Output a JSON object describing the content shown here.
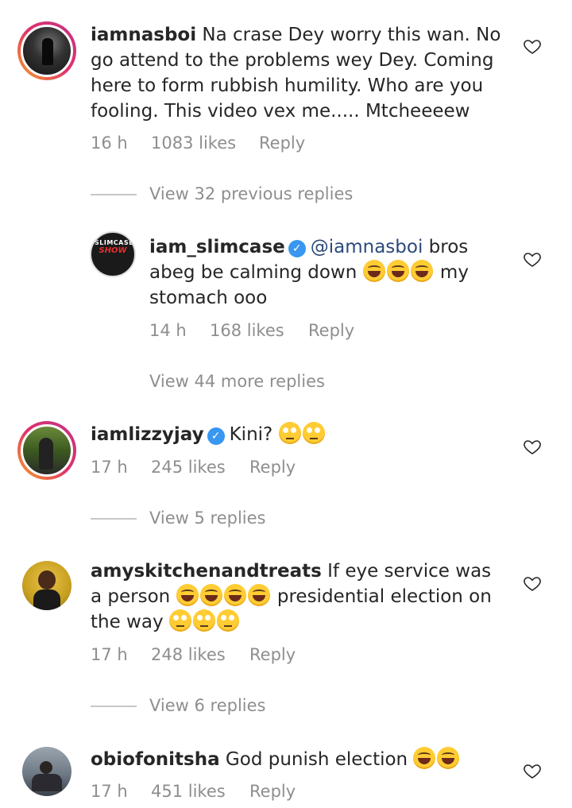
{
  "comments": [
    {
      "username": "iamnasboi",
      "text": "Na crase Dey worry this wan. No go attend to the problems wey Dey. Coming here to form rubbish humility. Who are you fooling. This video vex me..... Mtcheeeew",
      "time": "16 h",
      "likes": "1083 likes",
      "reply": "Reply"
    },
    {
      "username": "iam_slimcase",
      "verified": true,
      "mention": "@iamnasboi",
      "text_a": "bros abeg be calming down",
      "text_b": "my stomach ooo",
      "emojis": [
        "laughing-emoji",
        "laughing-emoji",
        "laughing-emoji"
      ],
      "time": "14 h",
      "likes": "168 likes",
      "reply": "Reply",
      "avatar_label_1": "SLIMCASE",
      "avatar_label_2": "SHOW"
    },
    {
      "username": "iamlizzyjay",
      "verified": true,
      "text": "Kini?",
      "emojis": [
        "eye-roll-emoji",
        "eye-roll-emoji"
      ],
      "time": "17 h",
      "likes": "245 likes",
      "reply": "Reply"
    },
    {
      "username": "amyskitchenandtreats",
      "text_a": "If eye service was a person",
      "text_b": "presidential election on the way",
      "emojis_a": [
        "rofl-emoji",
        "rofl-emoji",
        "rofl-emoji",
        "rofl-emoji"
      ],
      "emojis_b": [
        "eye-roll-emoji",
        "eye-roll-emoji",
        "eye-roll-emoji"
      ],
      "time": "17 h",
      "likes": "248 likes",
      "reply": "Reply"
    },
    {
      "username": "obiofonitsha",
      "text": "God punish election",
      "emojis": [
        "laughing-emoji",
        "laughing-emoji"
      ],
      "time": "17 h",
      "likes": "451 likes",
      "reply": "Reply"
    }
  ],
  "view_links": {
    "previous_replies": "View 32 previous replies",
    "more_replies": "View 44 more replies",
    "lizzy_replies": "View 5 replies",
    "amy_replies": "View 6 replies"
  },
  "colors": {
    "text": "#262626",
    "meta": "#8e8e8e",
    "mention": "#2b4a7a",
    "verified": "#3897f0"
  }
}
